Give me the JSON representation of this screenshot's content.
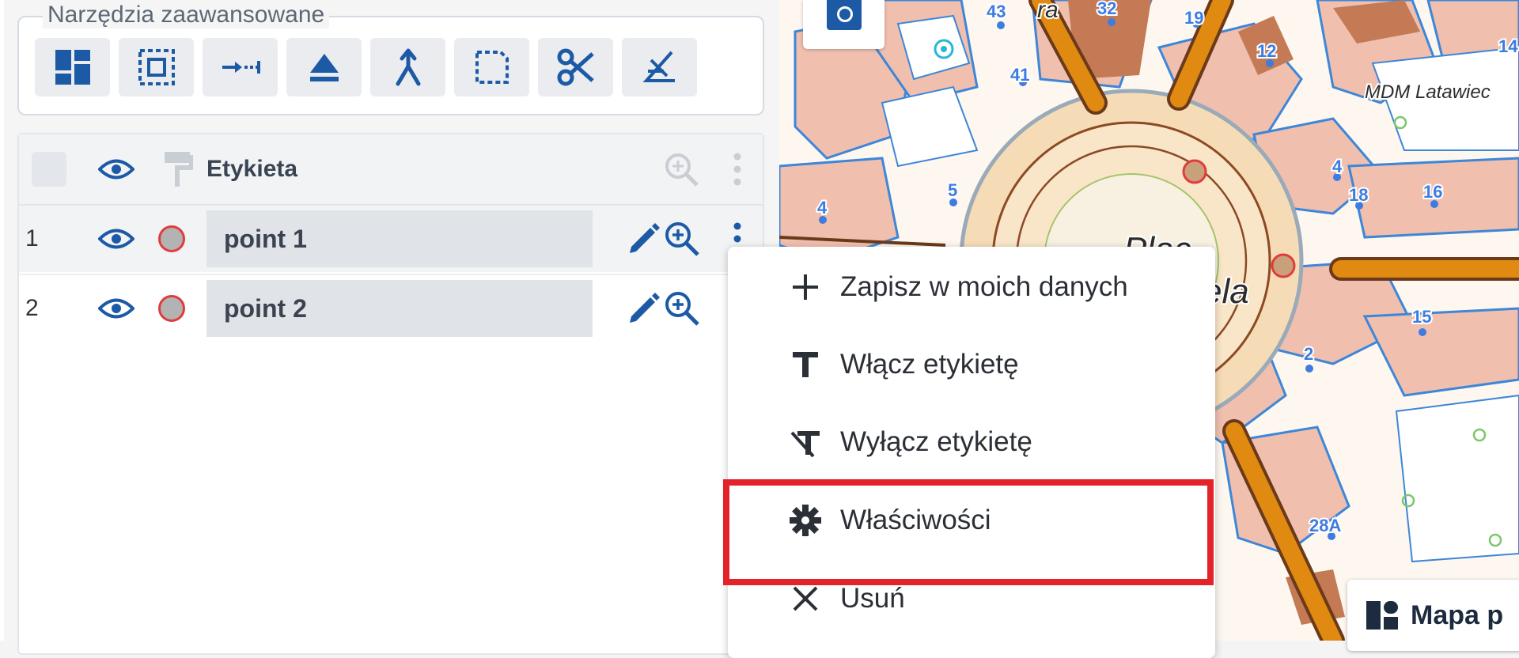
{
  "toolbox": {
    "legend": "Narzędzia zaawansowane",
    "tools": [
      {
        "icon": "grid-layout-icon"
      },
      {
        "icon": "select-area-icon"
      },
      {
        "icon": "measure-line-icon"
      },
      {
        "icon": "eject-triangle-icon"
      },
      {
        "icon": "merge-icon"
      },
      {
        "icon": "dashed-rectangle-icon"
      },
      {
        "icon": "scissors-icon"
      },
      {
        "icon": "angle-icon"
      }
    ]
  },
  "layers": {
    "header": {
      "label": "Etykieta"
    },
    "rows": [
      {
        "index": "1",
        "name": "point 1"
      },
      {
        "index": "2",
        "name": "point 2"
      }
    ]
  },
  "context_menu": {
    "items": [
      {
        "label": "Zapisz w moich danych",
        "icon": "plus-icon"
      },
      {
        "label": "Włącz etykietę",
        "icon": "text-t-icon"
      },
      {
        "label": "Wyłącz etykietę",
        "icon": "text-off-icon"
      },
      {
        "label": "Właściwości",
        "icon": "gear-icon",
        "highlighted": true
      },
      {
        "label": "Usuń",
        "icon": "close-icon"
      }
    ]
  },
  "map": {
    "labels": {
      "mdm": "MDM Latawiec",
      "plac": "Plac",
      "ela": "ela",
      "n43": "43",
      "n32": "32",
      "n19": "19",
      "n12": "12",
      "n14": "14",
      "n41": "41",
      "n4a": "4",
      "n18": "18",
      "n16": "16",
      "n5": "5",
      "n4b": "4",
      "n15": "15",
      "n2": "2",
      "n28a": "28A",
      "ra": "ra"
    },
    "base_button_label": "Mapa p"
  },
  "colors": {
    "accent": "#1c5aa6",
    "highlight": "#e3232a",
    "road": "#e08a12",
    "building": "#f0bfae"
  }
}
